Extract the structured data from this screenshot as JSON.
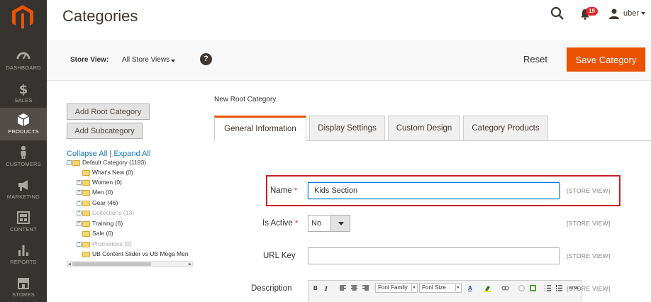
{
  "sidebar": {
    "items": [
      {
        "label": "DASHBOARD",
        "icon": "dashboard-icon"
      },
      {
        "label": "SALES",
        "icon": "dollar-icon"
      },
      {
        "label": "PRODUCTS",
        "icon": "cube-icon",
        "active": true
      },
      {
        "label": "CUSTOMERS",
        "icon": "person-icon"
      },
      {
        "label": "MARKETING",
        "icon": "megaphone-icon"
      },
      {
        "label": "CONTENT",
        "icon": "layout-icon"
      },
      {
        "label": "REPORTS",
        "icon": "bar-chart-icon"
      },
      {
        "label": "STORES",
        "icon": "store-icon"
      }
    ]
  },
  "header": {
    "title": "Categories",
    "notification_count": "19",
    "username": "uber"
  },
  "store_bar": {
    "label": "Store View:",
    "selected": "All Store Views",
    "help": "?",
    "reset_label": "Reset",
    "save_label": "Save Category"
  },
  "tree_panel": {
    "add_root_label": "Add Root Category",
    "add_sub_label": "Add Subcategory",
    "collapse_label": "Collapse All",
    "separator": "|",
    "expand_label": "Expand All",
    "nodes": [
      {
        "label": "Default Category (1183)",
        "expandable": true,
        "expanded": true,
        "disabled": false
      },
      {
        "label": "What's New (0)",
        "expandable": false,
        "disabled": false
      },
      {
        "label": "Women (0)",
        "expandable": true,
        "disabled": false
      },
      {
        "label": "Men (0)",
        "expandable": true,
        "disabled": false
      },
      {
        "label": "Gear (46)",
        "expandable": true,
        "disabled": false
      },
      {
        "label": "Collections (13)",
        "expandable": true,
        "disabled": true
      },
      {
        "label": "Training (6)",
        "expandable": true,
        "disabled": false
      },
      {
        "label": "Sale (0)",
        "expandable": false,
        "disabled": false
      },
      {
        "label": "Promotions (0)",
        "expandable": true,
        "disabled": true
      },
      {
        "label": "UB Content Slider vs UB Mega Men",
        "expandable": false,
        "disabled": false
      }
    ]
  },
  "form": {
    "section_label": "New Root Category",
    "tabs": [
      {
        "label": "General Information",
        "active": true
      },
      {
        "label": "Display Settings"
      },
      {
        "label": "Custom Design"
      },
      {
        "label": "Category Products"
      }
    ],
    "fields": {
      "name": {
        "label": "Name",
        "required_mark": "*",
        "value": "Kids Section",
        "scope": "[STORE VIEW]"
      },
      "is_active": {
        "label": "Is Active",
        "required_mark": "*",
        "value": "No",
        "scope": "[STORE VIEW]"
      },
      "url_key": {
        "label": "URL Key",
        "value": "",
        "scope": "[STORE VIEW]"
      },
      "description": {
        "label": "Description",
        "scope": "[STORE VIEW]"
      }
    },
    "editor_toolbar": {
      "bold": "B",
      "italic": "I",
      "font_family": "Font Family",
      "font_size": "Font Size",
      "text_color": "A",
      "html": "HTML"
    }
  },
  "colors": {
    "sidebar_bg": "#373330",
    "accent": "#eb5202",
    "link": "#1979c3",
    "highlight_border": "#c62127"
  }
}
